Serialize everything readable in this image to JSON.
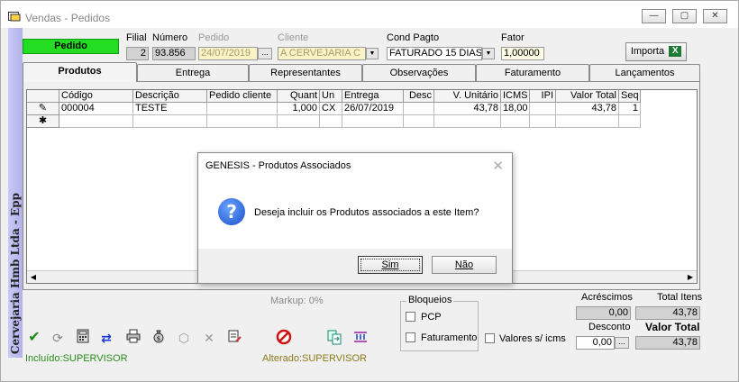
{
  "window": {
    "title": "Vendas - Pedidos",
    "minimize_glyph": "—",
    "maximize_glyph": "▢",
    "close_glyph": "✕"
  },
  "sidebar": {
    "company": "Cervejaria Hmb Ltda - Epp"
  },
  "header": {
    "status": "Pedido",
    "filial_label": "Filial",
    "filial_value": "2",
    "numero_label": "Número",
    "numero_value": "93.856",
    "pedido_label": "Pedido",
    "pedido_value": "24/07/2019",
    "cliente_label": "Cliente",
    "cliente_value": "A CERVEJARIA  C",
    "cond_pagto_label": "Cond Pagto",
    "cond_pagto_value": "FATURADO 15 DIAS",
    "fator_label": "Fator",
    "fator_value": "1,00000",
    "importa_label": "Importa",
    "ellipsis": "...",
    "dropdown_glyph": "▼"
  },
  "tabs": [
    {
      "label": "Produtos"
    },
    {
      "label": "Entrega"
    },
    {
      "label": "Representantes"
    },
    {
      "label": "Observações"
    },
    {
      "label": "Faturamento"
    },
    {
      "label": "Lançamentos"
    }
  ],
  "grid": {
    "columns": [
      "Código",
      "Descrição",
      "Pedido cliente",
      "Quant",
      "Un",
      "Entrega",
      "Desc",
      "V. Unitário",
      "ICMS",
      "IPI",
      "Valor Total",
      "Seq"
    ],
    "rows": [
      [
        "000004",
        "TESTE",
        "",
        "1,000",
        "CX",
        "26/07/2019",
        "",
        "43,78",
        "18,00",
        "",
        "43,78",
        "1"
      ]
    ],
    "edit_indicator": "✎",
    "new_indicator": "✱"
  },
  "dialog": {
    "title": "GENESIS - Produtos Associados",
    "message": "Deseja incluir os Produtos associados a este Item?",
    "yes_label": "Sim",
    "no_label": "Não",
    "close_glyph": "✕",
    "icon_glyph": "?"
  },
  "bottom": {
    "markup": "Markup: 0%",
    "bloqueios_label": "Bloqueios",
    "pcp_label": "PCP",
    "faturamento_label": "Faturamento",
    "valores_label": "Valores s/ icms",
    "acrescimos_label": "Acréscimos",
    "acrescimos_value": "0,00",
    "total_itens_label": "Total Itens",
    "total_itens_value": "43,78",
    "desconto_label": "Desconto",
    "desconto_value": "0,00",
    "valor_total_label": "Valor Total",
    "valor_total_value": "43,78",
    "incluido": "Incluído:SUPERVISOR",
    "alterado": "Alterado:SUPERVISOR"
  },
  "colors": {
    "status_green": "#22dd22",
    "sidebar": "#c0c0f0",
    "footer_text_green": "#2a8a1a",
    "footer_text_olive": "#8a7a1a"
  }
}
